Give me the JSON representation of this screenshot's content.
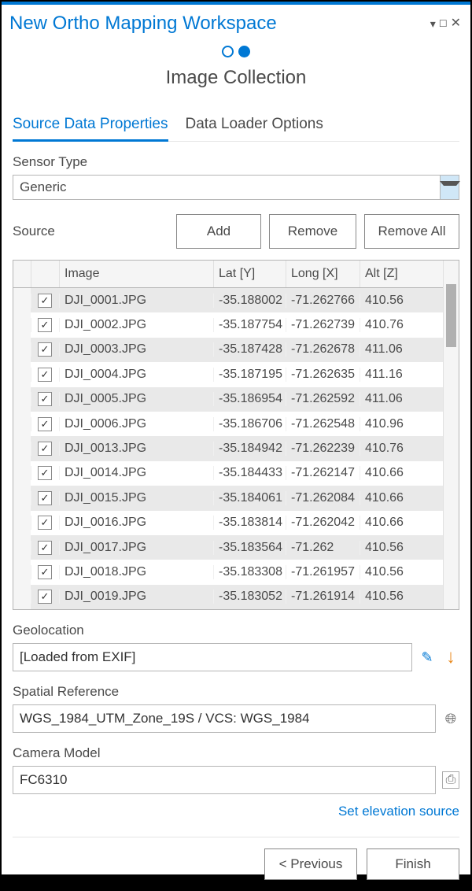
{
  "window": {
    "title": "New Ortho Mapping Workspace"
  },
  "section": {
    "heading": "Image Collection"
  },
  "tabs": {
    "source": "Source Data Properties",
    "loader": "Data Loader Options"
  },
  "sensor": {
    "label": "Sensor Type",
    "value": "Generic"
  },
  "source": {
    "label": "Source",
    "add": "Add",
    "remove": "Remove",
    "removeAll": "Remove All"
  },
  "columns": {
    "image": "Image",
    "lat": "Lat [Y]",
    "long": "Long [X]",
    "alt": "Alt [Z]"
  },
  "rows": [
    {
      "chk": true,
      "image": "DJI_0001.JPG",
      "lat": "-35.188002",
      "long": "-71.262766",
      "alt": "410.56"
    },
    {
      "chk": true,
      "image": "DJI_0002.JPG",
      "lat": "-35.187754",
      "long": "-71.262739",
      "alt": "410.76"
    },
    {
      "chk": true,
      "image": "DJI_0003.JPG",
      "lat": "-35.187428",
      "long": "-71.262678",
      "alt": "411.06"
    },
    {
      "chk": true,
      "image": "DJI_0004.JPG",
      "lat": "-35.187195",
      "long": "-71.262635",
      "alt": "411.16"
    },
    {
      "chk": true,
      "image": "DJI_0005.JPG",
      "lat": "-35.186954",
      "long": "-71.262592",
      "alt": "411.06"
    },
    {
      "chk": true,
      "image": "DJI_0006.JPG",
      "lat": "-35.186706",
      "long": "-71.262548",
      "alt": "410.96"
    },
    {
      "chk": true,
      "image": "DJI_0013.JPG",
      "lat": "-35.184942",
      "long": "-71.262239",
      "alt": "410.76"
    },
    {
      "chk": true,
      "image": "DJI_0014.JPG",
      "lat": "-35.184433",
      "long": "-71.262147",
      "alt": "410.66"
    },
    {
      "chk": true,
      "image": "DJI_0015.JPG",
      "lat": "-35.184061",
      "long": "-71.262084",
      "alt": "410.66"
    },
    {
      "chk": true,
      "image": "DJI_0016.JPG",
      "lat": "-35.183814",
      "long": "-71.262042",
      "alt": "410.66"
    },
    {
      "chk": true,
      "image": "DJI_0017.JPG",
      "lat": "-35.183564",
      "long": "-71.262",
      "alt": "410.56"
    },
    {
      "chk": true,
      "image": "DJI_0018.JPG",
      "lat": "-35.183308",
      "long": "-71.261957",
      "alt": "410.56"
    },
    {
      "chk": true,
      "image": "DJI_0019.JPG",
      "lat": "-35.183052",
      "long": "-71.261914",
      "alt": "410.56"
    }
  ],
  "geolocation": {
    "label": "Geolocation",
    "value": "[Loaded from EXIF]"
  },
  "spatial": {
    "label": "Spatial Reference",
    "value": "WGS_1984_UTM_Zone_19S / VCS: WGS_1984"
  },
  "camera": {
    "label": "Camera Model",
    "value": "FC6310"
  },
  "elevation": {
    "link": "Set elevation source"
  },
  "footer": {
    "previous": "< Previous",
    "finish": "Finish"
  }
}
